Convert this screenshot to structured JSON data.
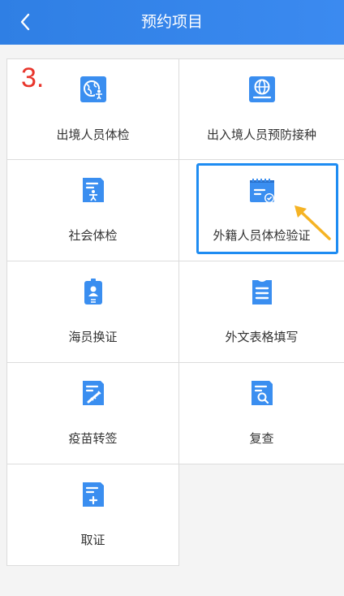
{
  "header": {
    "title": "预约项目",
    "back_icon": "chevron-left-icon",
    "background_color": "#3584ea"
  },
  "annotation": {
    "step_number": "3.",
    "step_color": "#e8352b",
    "highlight_color": "#1e8cf2",
    "arrow_color": "#f5b324"
  },
  "items": [
    {
      "label": "出境人员体检",
      "icon": "globe-person-icon"
    },
    {
      "label": "出入境人员预防接种",
      "icon": "globe-icon"
    },
    {
      "label": "社会体检",
      "icon": "document-person-icon"
    },
    {
      "label": "外籍人员体检验证",
      "icon": "calendar-check-icon"
    },
    {
      "label": "海员换证",
      "icon": "id-badge-icon"
    },
    {
      "label": "外文表格填写",
      "icon": "clipboard-list-icon"
    },
    {
      "label": "疫苗转签",
      "icon": "document-syringe-icon"
    },
    {
      "label": "复查",
      "icon": "document-search-icon"
    },
    {
      "label": "取证",
      "icon": "document-plus-icon"
    }
  ],
  "icon_color": "#3a8ef0"
}
